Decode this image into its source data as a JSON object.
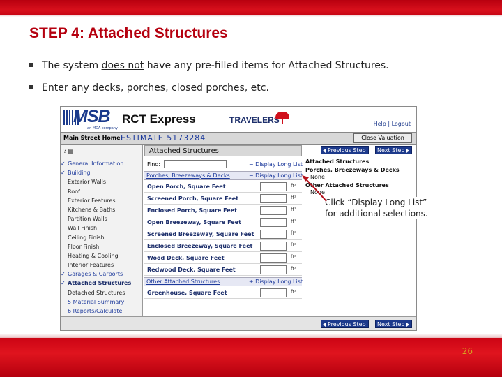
{
  "slide": {
    "title": "STEP 4:  Attached Structures",
    "bullet1_pre": "The system ",
    "bullet1_u": "does not",
    "bullet1_post": " have any pre-filled items for Attached Structures.",
    "bullet2": "Enter any decks, porches, closed porches, etc.",
    "page_number": "26",
    "callout_line1": "Click “Display Long List”",
    "callout_line2": "for additional selections."
  },
  "app": {
    "logo": "MSB",
    "logo_sub": "an MDA company",
    "product": "RCT Express",
    "brand": "TRAVELERS",
    "links": "Help | Logout",
    "main_street_label": "Main Street Home:",
    "estimate": "ESTIMATE 5173284",
    "close_button": "Close Valuation"
  },
  "sidebar": {
    "items": [
      {
        "label": "General Information",
        "checked": true
      },
      {
        "label": "Building",
        "checked": true
      },
      {
        "label": "Exterior Walls"
      },
      {
        "label": "Roof"
      },
      {
        "label": "Exterior Features"
      },
      {
        "label": "Kitchens & Baths"
      },
      {
        "label": "Partition Walls"
      },
      {
        "label": "Wall Finish"
      },
      {
        "label": "Ceiling Finish"
      },
      {
        "label": "Floor Finish"
      },
      {
        "label": "Heating & Cooling"
      },
      {
        "label": "Interior Features"
      },
      {
        "label": "Garages & Carports",
        "checked": true
      },
      {
        "label": "Attached Structures",
        "checked": true,
        "active": true
      },
      {
        "label": "Detached Structures"
      },
      {
        "label": "5 Material Summary",
        "num": true
      },
      {
        "label": "6 Reports/Calculate",
        "num": true
      }
    ]
  },
  "main": {
    "header": "Attached Structures",
    "prev_label": "Previous Step",
    "next_label": "Next Step",
    "find_label": "Find:",
    "display_long_list_minus": "− Display Long List",
    "display_long_list_plus": "+ Display Long List",
    "section1": "Porches, Breezeways & Decks",
    "section2": "Other Attached Structures",
    "unit": "ft²",
    "rows1": [
      "Open Porch, Square Feet",
      "Screened Porch, Square Feet",
      "Enclosed Porch, Square Feet",
      "Open Breezeway, Square Feet",
      "Screened Breezeway, Square Feet",
      "Enclosed Breezeway, Square Feet",
      "Wood Deck, Square Feet",
      "Redwood Deck, Square Feet"
    ],
    "rows2": [
      "Greenhouse, Square Feet"
    ]
  },
  "right_panel": {
    "title": "Attached Structures",
    "sec1": "Porches, Breezeways & Decks",
    "none1": "None",
    "sec2": "Other Attached Structures",
    "none2": "None"
  }
}
